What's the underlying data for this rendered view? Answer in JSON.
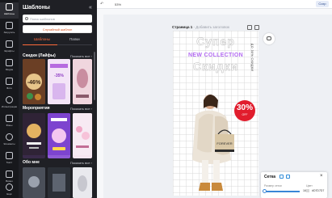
{
  "rail": {
    "items": [
      {
        "label": "Шаблоны",
        "icon": "templates-icon",
        "active": true
      },
      {
        "label": "Загрузить",
        "icon": "upload-icon",
        "active": false
      },
      {
        "label": "Шрифты",
        "icon": "font-icon",
        "active": false
      },
      {
        "label": "Медиа",
        "icon": "media-icon",
        "active": false
      },
      {
        "label": "Фото",
        "icon": "photo-icon",
        "active": false
      },
      {
        "label": "Иллюстрации",
        "icon": "illustrations-icon",
        "active": false
      },
      {
        "label": "Фоны",
        "icon": "backgrounds-icon",
        "active": false
      },
      {
        "label": "Элементы",
        "icon": "elements-icon",
        "active": false
      },
      {
        "label": "Текст",
        "icon": "text-icon",
        "active": false
      },
      {
        "label": "Видео",
        "icon": "video-icon",
        "active": false
      },
      {
        "label": "Ещё",
        "icon": "more-icon",
        "active": false
      }
    ]
  },
  "panel": {
    "title": "Шаблоны",
    "close": "«",
    "search_placeholder": "Поиск шаблонов",
    "random_button": "Случайный шаблон",
    "tabs": [
      "Шаблоны",
      "Папки"
    ],
    "sections": [
      {
        "title": "Скидки (Лайфы)",
        "show_all": "Показать все ›"
      },
      {
        "title": "Мероприятия",
        "show_all": "Показать все ›"
      },
      {
        "title": "Обо мне",
        "show_all": "Показать все ›"
      }
    ],
    "thumbnails": [
      {
        "text": "-46%",
        "bg": "#7a4b2e"
      },
      {
        "text": "СКИДКА -35%",
        "bg": "#c9a6e6"
      },
      {
        "text": "",
        "bg": "#f1d8de"
      },
      {
        "text": "",
        "bg": "#3a2a4a"
      },
      {
        "text": "",
        "bg": "#8f5bd6"
      },
      {
        "text": "",
        "bg": "#f6e5f0"
      },
      {
        "text": "",
        "bg": "#4a4f59"
      },
      {
        "text": "",
        "bg": "#2b2f36"
      }
    ]
  },
  "topbar": {
    "zoom": "53%",
    "save": "Сохр"
  },
  "canvas": {
    "page_label": "Страница 1",
    "page_sub": "- Добавить заголовок",
    "headline_1": "Супер",
    "headline_2": "NEW COLLECTION",
    "headline_3": "Скидки",
    "vertical_text": "ДО 30% СКИДКИ",
    "badge_percent": "30%",
    "badge_off": "OFF",
    "bag_text": "FOREVER"
  },
  "popup": {
    "title": "Сетка",
    "close": "×",
    "label_size": "Размер сетки",
    "label_color": "Цвет",
    "size_value": "16",
    "color_value": "#D7D7D7"
  },
  "colors": {
    "accent": "#ff6a3a",
    "badge": "#e11d2d",
    "headline_purple": "#b36bf2"
  }
}
